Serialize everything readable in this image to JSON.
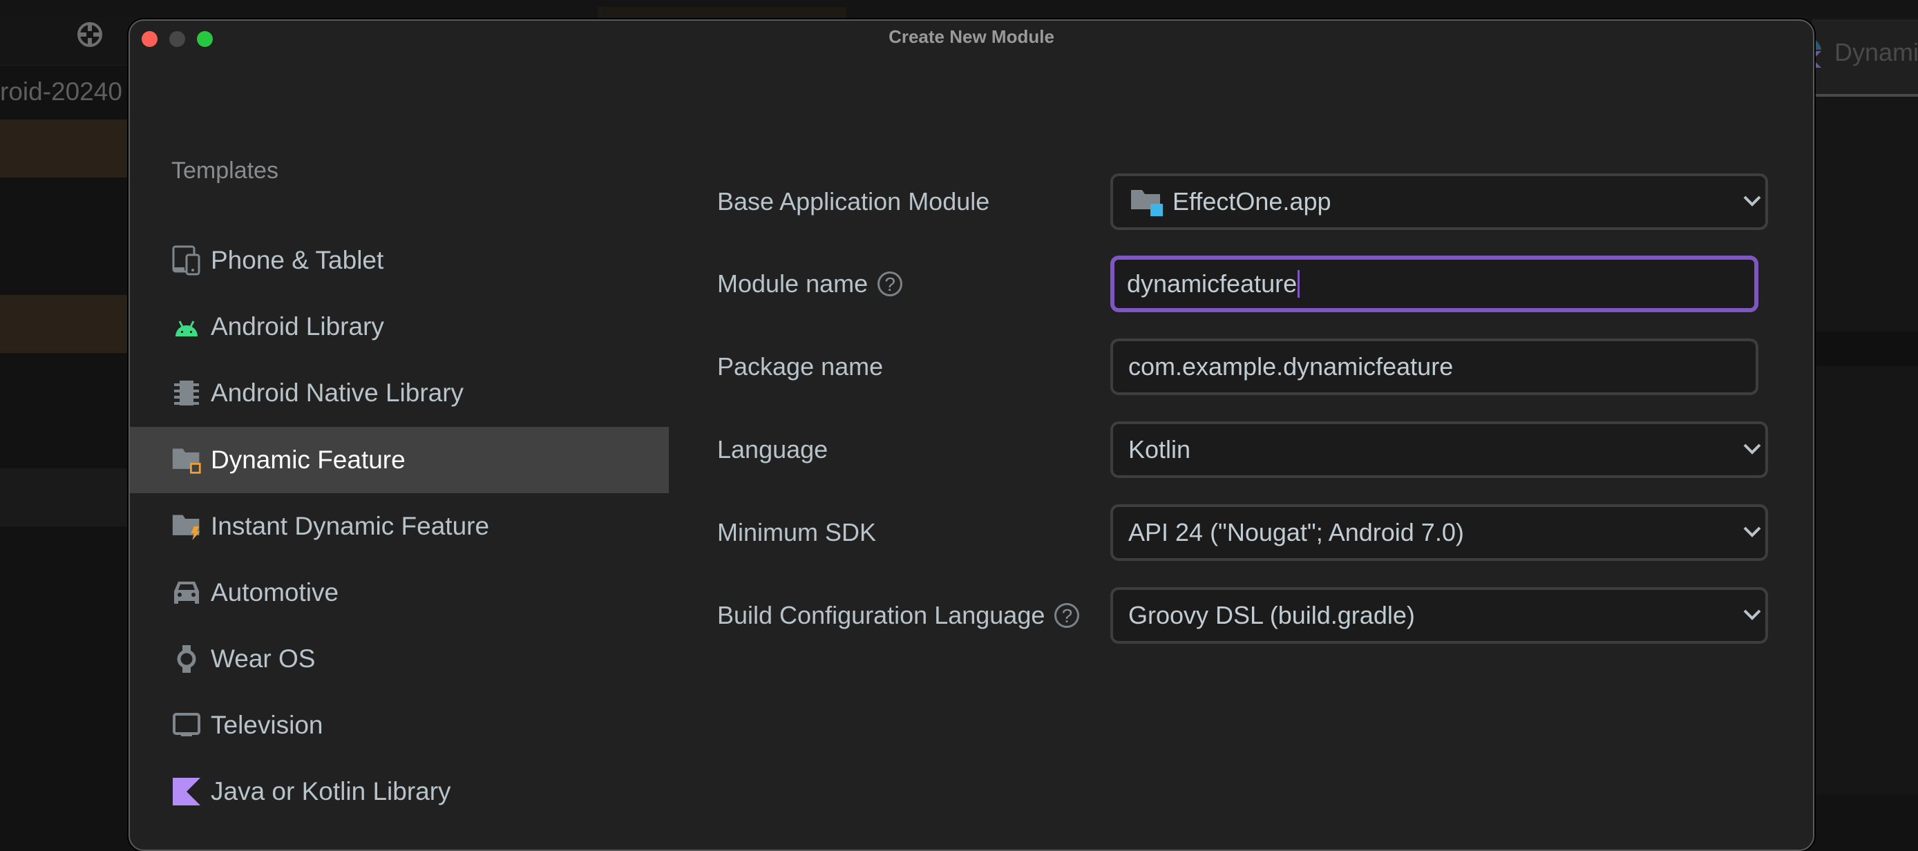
{
  "background": {
    "project_label": "roid-20240",
    "right_tab_label": "Dynami"
  },
  "dialog": {
    "title": "Create New Module",
    "window_controls": [
      "close",
      "minimize",
      "maximize"
    ]
  },
  "sidebar": {
    "heading": "Templates",
    "selected_index": 3,
    "items": [
      {
        "label": "Phone & Tablet",
        "icon": "phone-tablet-icon"
      },
      {
        "label": "Android Library",
        "icon": "android-icon"
      },
      {
        "label": "Android Native Library",
        "icon": "chip-icon"
      },
      {
        "label": "Dynamic Feature",
        "icon": "dynamic-feature-folder-icon"
      },
      {
        "label": "Instant Dynamic Feature",
        "icon": "instant-feature-folder-icon"
      },
      {
        "label": "Automotive",
        "icon": "car-icon"
      },
      {
        "label": "Wear OS",
        "icon": "watch-icon"
      },
      {
        "label": "Television",
        "icon": "tv-icon"
      },
      {
        "label": "Java or Kotlin Library",
        "icon": "kotlin-icon"
      }
    ]
  },
  "form": {
    "base_module": {
      "label": "Base Application Module",
      "value": "EffectOne.app"
    },
    "module_name": {
      "label": "Module name",
      "value": "dynamicfeature",
      "help": "?"
    },
    "package_name": {
      "label": "Package name",
      "value": "com.example.dynamicfeature"
    },
    "language": {
      "label": "Language",
      "value": "Kotlin"
    },
    "min_sdk": {
      "label": "Minimum SDK",
      "value": "API 24 (\"Nougat\"; Android 7.0)"
    },
    "build_config": {
      "label": "Build Configuration Language",
      "value": "Groovy DSL (build.gradle)",
      "help": "?"
    }
  },
  "colors": {
    "accent_focus": "#7f57c2",
    "android_green": "#3ddc84",
    "kotlin_purple": "#b48ef6",
    "feature_orange": "#f0a030",
    "module_blue": "#3fb4e6"
  }
}
